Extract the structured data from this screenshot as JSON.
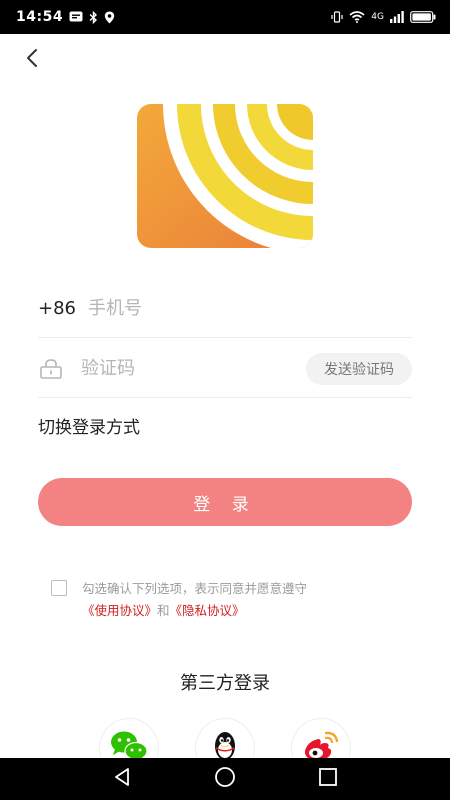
{
  "status_bar": {
    "time": "14:54",
    "network_label": "4G",
    "icons": [
      "message-icon",
      "bluetooth-icon",
      "location-icon",
      "vibrate-icon",
      "wifi-icon",
      "signal-icon",
      "battery-icon"
    ]
  },
  "header": {
    "back_icon": "chevron-left-icon"
  },
  "logo": {
    "colors": {
      "orange": "#ee8f3c",
      "yellow": "#f3d83a",
      "white": "#ffffff"
    }
  },
  "phone_field": {
    "country_code": "+86",
    "placeholder": "手机号",
    "value": ""
  },
  "code_field": {
    "icon": "lock-icon",
    "placeholder": "验证码",
    "value": "",
    "send_button": "发送验证码"
  },
  "switch_login": "切换登录方式",
  "login_button": "登 录",
  "agreement": {
    "checked": false,
    "text": "勾选确认下列选项，表示同意并愿意遵守",
    "terms": "《使用协议》",
    "and": "和",
    "privacy": "《隐私协议》"
  },
  "third_party": {
    "title": "第三方登录",
    "providers": [
      "wechat",
      "qq",
      "weibo"
    ]
  },
  "colors": {
    "accent": "#f38383",
    "link": "#d21f1f"
  }
}
